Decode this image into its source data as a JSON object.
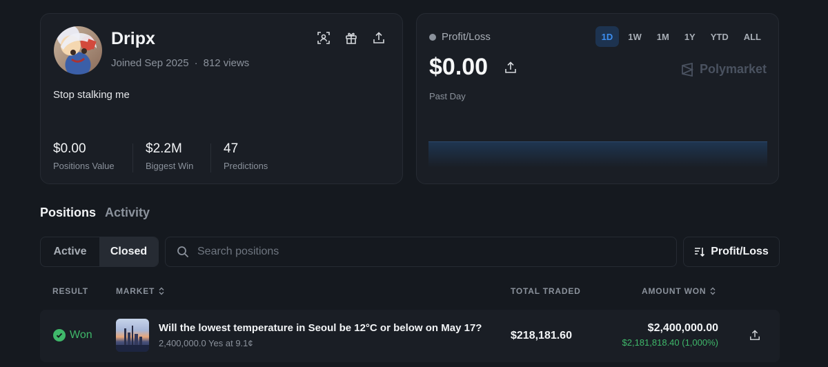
{
  "profile": {
    "name": "Dripx",
    "joined": "Joined Sep 2025",
    "separator": "·",
    "views": "812 views",
    "bio": "Stop stalking me",
    "stats": [
      {
        "value": "$0.00",
        "label": "Positions Value"
      },
      {
        "value": "$2.2M",
        "label": "Biggest Win"
      },
      {
        "value": "47",
        "label": "Predictions"
      }
    ]
  },
  "pnl": {
    "label": "Profit/Loss",
    "value": "$0.00",
    "period": "Past Day",
    "brand": "Polymarket",
    "ranges": [
      "1D",
      "1W",
      "1M",
      "1Y",
      "YTD",
      "ALL"
    ],
    "active_range": "1D"
  },
  "tabs": {
    "positions": "Positions",
    "activity": "Activity"
  },
  "filters": {
    "active": "Active",
    "closed": "Closed",
    "search_placeholder": "Search positions",
    "sort": "Profit/Loss"
  },
  "table": {
    "headers": {
      "result": "RESULT",
      "market": "MARKET",
      "total_traded": "TOTAL TRADED",
      "amount_won": "AMOUNT WON"
    },
    "rows": [
      {
        "result": "Won",
        "title": "Will the lowest temperature in Seoul be 12°C or below on May 17?",
        "subtitle": "2,400,000.0 Yes at 9.1¢",
        "total_traded": "$218,181.60",
        "amount_won": "$2,400,000.00",
        "gain": "$2,181,818.40 (1,000%)"
      }
    ]
  },
  "colors": {
    "background": "#15191f",
    "card": "#1a1e25",
    "accent": "#3d8ef0",
    "positive": "#3fb86a"
  }
}
